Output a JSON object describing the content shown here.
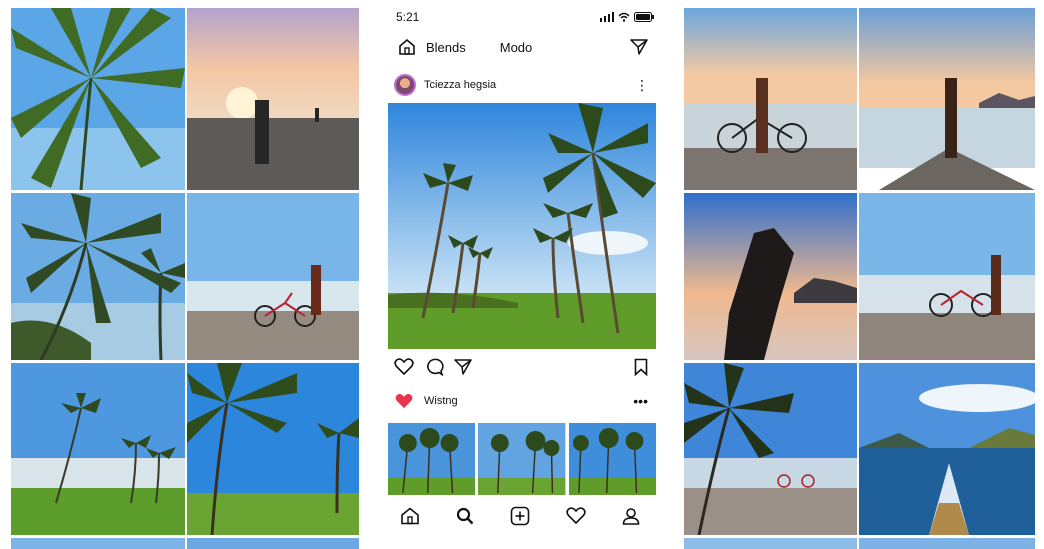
{
  "status_bar": {
    "time": "5:21"
  },
  "top_nav": {
    "tab_blends": "Blends",
    "tab_modo": "Modo",
    "home_icon": "home-icon",
    "direct_icon": "send-icon"
  },
  "post": {
    "username": "Tciezza hegsia",
    "more_icon": "more-icon",
    "image_description": "palm-tree-avenue",
    "actions": [
      "like-icon",
      "comment-icon",
      "share-icon",
      "bookmark-icon"
    ]
  },
  "likes": {
    "text": "Wistng",
    "heart_color": "#e8344e"
  },
  "bottom_nav": [
    "home-icon",
    "search-icon",
    "create-icon",
    "activity-icon",
    "profile-icon"
  ],
  "colors": {
    "sky_top": "#3f8fdb",
    "sky_bottom": "#cfe6f8",
    "grass": "#5f9a2c",
    "sand": "#8c8378",
    "sea": "#bfcbd4",
    "sunset": "#f2c39a",
    "heart": "#e8344e"
  }
}
